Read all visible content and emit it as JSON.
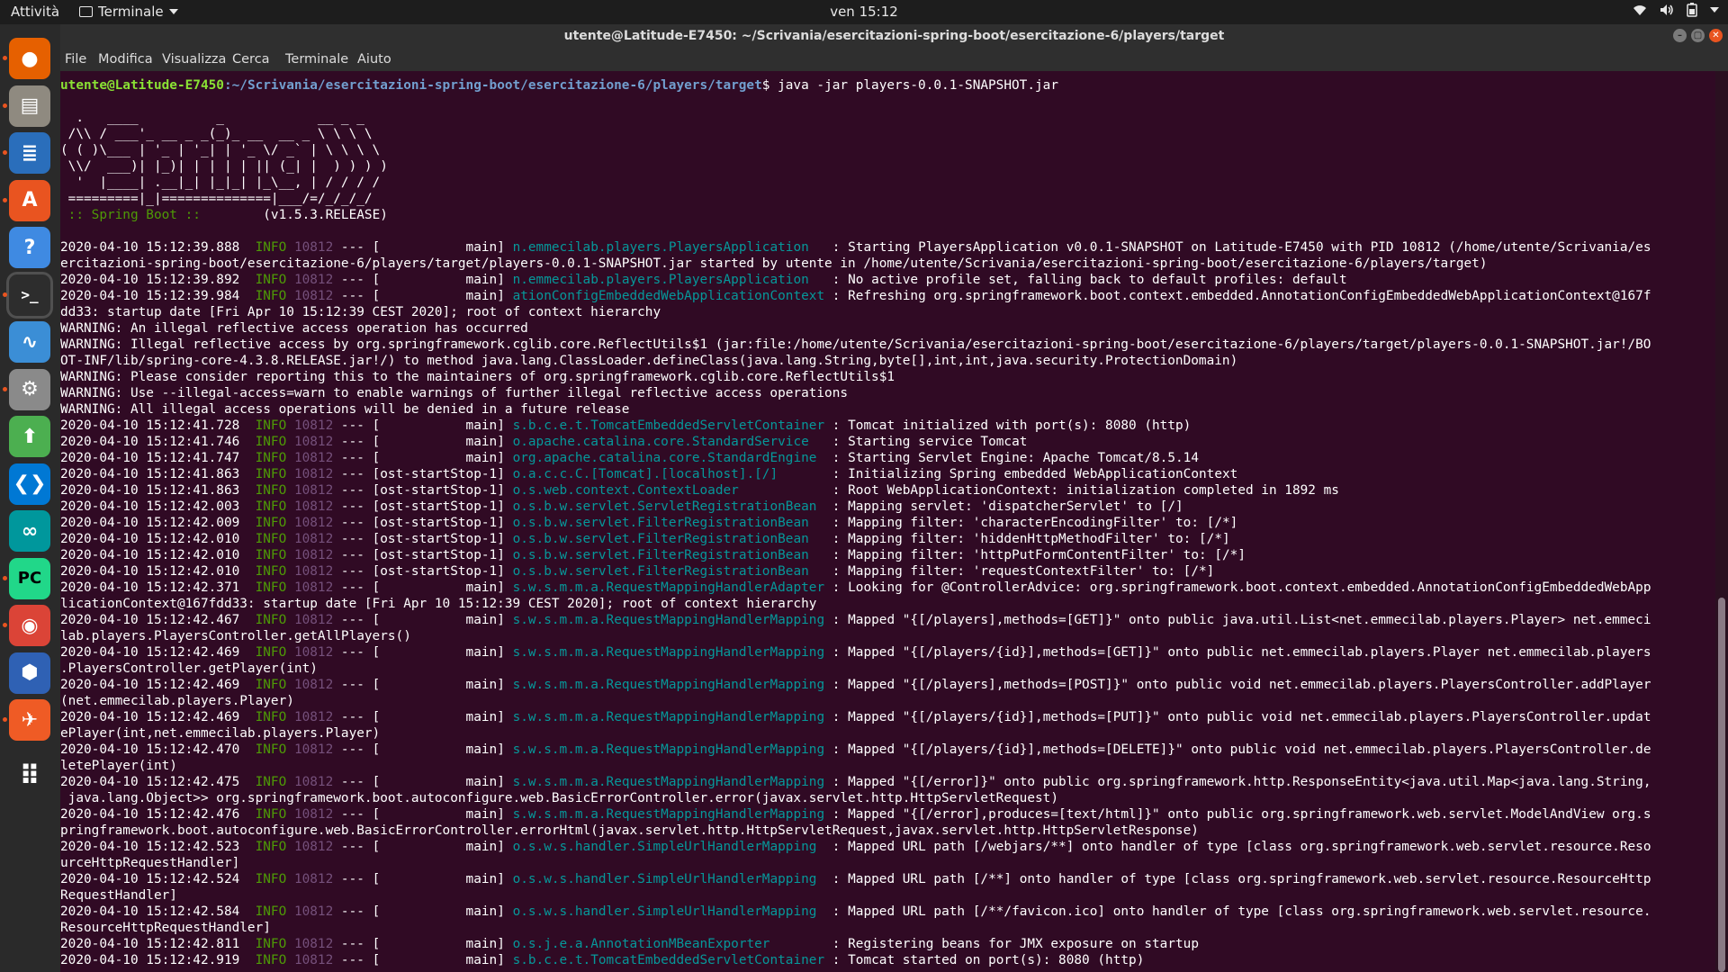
{
  "topbar": {
    "activities": "Attività",
    "app_name": "Terminale",
    "clock": "ven 15:12"
  },
  "dock": {
    "items": [
      {
        "name": "firefox-icon",
        "color": "#e66000"
      },
      {
        "name": "files-icon",
        "color": "#8f8a80"
      },
      {
        "name": "writer-icon",
        "color": "#2a6ebb"
      },
      {
        "name": "software-icon",
        "color": "#e95420"
      },
      {
        "name": "help-icon",
        "color": "#3f8ae2"
      },
      {
        "name": "terminal-icon",
        "color": "#2d2d2d"
      },
      {
        "name": "monitor-icon",
        "color": "#3b8ed6"
      },
      {
        "name": "settings-icon",
        "color": "#8a8a8a"
      },
      {
        "name": "package-icon",
        "color": "#4caf50"
      },
      {
        "name": "vscode-icon",
        "color": "#0078d4"
      },
      {
        "name": "arduino-icon",
        "color": "#00979c"
      },
      {
        "name": "pycharm-icon",
        "color": "#21d789"
      },
      {
        "name": "chrome-icon",
        "color": "#db4437"
      },
      {
        "name": "virtualbox-icon",
        "color": "#2f61b4"
      },
      {
        "name": "postman-icon",
        "color": "#ef5b25"
      },
      {
        "name": "app-grid-icon",
        "color": "#2a2a2a"
      }
    ]
  },
  "window": {
    "title": "utente@Latitude-E7450: ~/Scrivania/esercitazioni-spring-boot/esercitazione-6/players/target"
  },
  "menubar": {
    "items": [
      "File",
      "Modifica",
      "Visualizza",
      "Cerca",
      "Terminale",
      "Aiuto"
    ]
  },
  "terminal": {
    "prompt_user": "utente@Latitude-E7450",
    "prompt_path": ":~/Scrivania/esercitazioni-spring-boot/esercitazione-6/players/target",
    "prompt_sign": "$ ",
    "command": "java -jar players-0.0.1-SNAPSHOT.jar",
    "banner": [
      "  .   ____          _            __ _ _",
      " /\\\\ / ___'_ __ _ _(_)_ __  __ _ \\ \\ \\ \\",
      "( ( )\\___ | '_ | '_| | '_ \\/ _` | \\ \\ \\ \\",
      " \\\\/  ___)| |_)| | | | | || (_| |  ) ) ) )",
      "  '  |____| .__|_| |_|_| |_\\__, | / / / /",
      " =========|_|==============|___/=/_/_/_/"
    ],
    "spring_tag": " :: Spring Boot :: ",
    "spring_version": "       (v1.5.3.RELEASE)",
    "lines": [
      {
        "t": "log",
        "ts": "2020-04-10 15:12:39.888",
        "lvl": "INFO",
        "pid": "10812",
        "th": "[           main]",
        "lg": "n.emmecilab.players.PlayersApplication   ",
        "msg": ": Starting PlayersApplication v0.0.1-SNAPSHOT on Latitude-E7450 with PID 10812 (/home/utente/Scrivania/es"
      },
      {
        "t": "plain",
        "text": "ercitazioni-spring-boot/esercitazione-6/players/target/players-0.0.1-SNAPSHOT.jar started by utente in /home/utente/Scrivania/esercitazioni-spring-boot/esercitazione-6/players/target)"
      },
      {
        "t": "log",
        "ts": "2020-04-10 15:12:39.892",
        "lvl": "INFO",
        "pid": "10812",
        "th": "[           main]",
        "lg": "n.emmecilab.players.PlayersApplication   ",
        "msg": ": No active profile set, falling back to default profiles: default"
      },
      {
        "t": "log",
        "ts": "2020-04-10 15:12:39.984",
        "lvl": "INFO",
        "pid": "10812",
        "th": "[           main]",
        "lg": "ationConfigEmbeddedWebApplicationContext ",
        "msg": ": Refreshing org.springframework.boot.context.embedded.AnnotationConfigEmbeddedWebApplicationContext@167f"
      },
      {
        "t": "plain",
        "text": "dd33: startup date [Fri Apr 10 15:12:39 CEST 2020]; root of context hierarchy"
      },
      {
        "t": "plain",
        "text": "WARNING: An illegal reflective access operation has occurred"
      },
      {
        "t": "plain",
        "text": "WARNING: Illegal reflective access by org.springframework.cglib.core.ReflectUtils$1 (jar:file:/home/utente/Scrivania/esercitazioni-spring-boot/esercitazione-6/players/target/players-0.0.1-SNAPSHOT.jar!/BO"
      },
      {
        "t": "plain",
        "text": "OT-INF/lib/spring-core-4.3.8.RELEASE.jar!/) to method java.lang.ClassLoader.defineClass(java.lang.String,byte[],int,int,java.security.ProtectionDomain)"
      },
      {
        "t": "plain",
        "text": "WARNING: Please consider reporting this to the maintainers of org.springframework.cglib.core.ReflectUtils$1"
      },
      {
        "t": "plain",
        "text": "WARNING: Use --illegal-access=warn to enable warnings of further illegal reflective access operations"
      },
      {
        "t": "plain",
        "text": "WARNING: All illegal access operations will be denied in a future release"
      },
      {
        "t": "log",
        "ts": "2020-04-10 15:12:41.728",
        "lvl": "INFO",
        "pid": "10812",
        "th": "[           main]",
        "lg": "s.b.c.e.t.TomcatEmbeddedServletContainer ",
        "msg": ": Tomcat initialized with port(s): 8080 (http)"
      },
      {
        "t": "log",
        "ts": "2020-04-10 15:12:41.746",
        "lvl": "INFO",
        "pid": "10812",
        "th": "[           main]",
        "lg": "o.apache.catalina.core.StandardService   ",
        "msg": ": Starting service Tomcat"
      },
      {
        "t": "log",
        "ts": "2020-04-10 15:12:41.747",
        "lvl": "INFO",
        "pid": "10812",
        "th": "[           main]",
        "lg": "org.apache.catalina.core.StandardEngine  ",
        "msg": ": Starting Servlet Engine: Apache Tomcat/8.5.14"
      },
      {
        "t": "log",
        "ts": "2020-04-10 15:12:41.863",
        "lvl": "INFO",
        "pid": "10812",
        "th": "[ost-startStop-1]",
        "lg": "o.a.c.c.C.[Tomcat].[localhost].[/]       ",
        "msg": ": Initializing Spring embedded WebApplicationContext"
      },
      {
        "t": "log",
        "ts": "2020-04-10 15:12:41.863",
        "lvl": "INFO",
        "pid": "10812",
        "th": "[ost-startStop-1]",
        "lg": "o.s.web.context.ContextLoader            ",
        "msg": ": Root WebApplicationContext: initialization completed in 1892 ms"
      },
      {
        "t": "log",
        "ts": "2020-04-10 15:12:42.003",
        "lvl": "INFO",
        "pid": "10812",
        "th": "[ost-startStop-1]",
        "lg": "o.s.b.w.servlet.ServletRegistrationBean  ",
        "msg": ": Mapping servlet: 'dispatcherServlet' to [/]"
      },
      {
        "t": "log",
        "ts": "2020-04-10 15:12:42.009",
        "lvl": "INFO",
        "pid": "10812",
        "th": "[ost-startStop-1]",
        "lg": "o.s.b.w.servlet.FilterRegistrationBean   ",
        "msg": ": Mapping filter: 'characterEncodingFilter' to: [/*]"
      },
      {
        "t": "log",
        "ts": "2020-04-10 15:12:42.010",
        "lvl": "INFO",
        "pid": "10812",
        "th": "[ost-startStop-1]",
        "lg": "o.s.b.w.servlet.FilterRegistrationBean   ",
        "msg": ": Mapping filter: 'hiddenHttpMethodFilter' to: [/*]"
      },
      {
        "t": "log",
        "ts": "2020-04-10 15:12:42.010",
        "lvl": "INFO",
        "pid": "10812",
        "th": "[ost-startStop-1]",
        "lg": "o.s.b.w.servlet.FilterRegistrationBean   ",
        "msg": ": Mapping filter: 'httpPutFormContentFilter' to: [/*]"
      },
      {
        "t": "log",
        "ts": "2020-04-10 15:12:42.010",
        "lvl": "INFO",
        "pid": "10812",
        "th": "[ost-startStop-1]",
        "lg": "o.s.b.w.servlet.FilterRegistrationBean   ",
        "msg": ": Mapping filter: 'requestContextFilter' to: [/*]"
      },
      {
        "t": "log",
        "ts": "2020-04-10 15:12:42.371",
        "lvl": "INFO",
        "pid": "10812",
        "th": "[           main]",
        "lg": "s.w.s.m.m.a.RequestMappingHandlerAdapter ",
        "msg": ": Looking for @ControllerAdvice: org.springframework.boot.context.embedded.AnnotationConfigEmbeddedWebApp"
      },
      {
        "t": "plain",
        "text": "licationContext@167fdd33: startup date [Fri Apr 10 15:12:39 CEST 2020]; root of context hierarchy"
      },
      {
        "t": "log",
        "ts": "2020-04-10 15:12:42.467",
        "lvl": "INFO",
        "pid": "10812",
        "th": "[           main]",
        "lg": "s.w.s.m.m.a.RequestMappingHandlerMapping ",
        "msg": ": Mapped \"{[/players],methods=[GET]}\" onto public java.util.List<net.emmecilab.players.Player> net.emmeci"
      },
      {
        "t": "plain",
        "text": "lab.players.PlayersController.getAllPlayers()"
      },
      {
        "t": "log",
        "ts": "2020-04-10 15:12:42.469",
        "lvl": "INFO",
        "pid": "10812",
        "th": "[           main]",
        "lg": "s.w.s.m.m.a.RequestMappingHandlerMapping ",
        "msg": ": Mapped \"{[/players/{id}],methods=[GET]}\" onto public net.emmecilab.players.Player net.emmecilab.players"
      },
      {
        "t": "plain",
        "text": ".PlayersController.getPlayer(int)"
      },
      {
        "t": "log",
        "ts": "2020-04-10 15:12:42.469",
        "lvl": "INFO",
        "pid": "10812",
        "th": "[           main]",
        "lg": "s.w.s.m.m.a.RequestMappingHandlerMapping ",
        "msg": ": Mapped \"{[/players],methods=[POST]}\" onto public void net.emmecilab.players.PlayersController.addPlayer"
      },
      {
        "t": "plain",
        "text": "(net.emmecilab.players.Player)"
      },
      {
        "t": "log",
        "ts": "2020-04-10 15:12:42.469",
        "lvl": "INFO",
        "pid": "10812",
        "th": "[           main]",
        "lg": "s.w.s.m.m.a.RequestMappingHandlerMapping ",
        "msg": ": Mapped \"{[/players/{id}],methods=[PUT]}\" onto public void net.emmecilab.players.PlayersController.updat"
      },
      {
        "t": "plain",
        "text": "ePlayer(int,net.emmecilab.players.Player)"
      },
      {
        "t": "log",
        "ts": "2020-04-10 15:12:42.470",
        "lvl": "INFO",
        "pid": "10812",
        "th": "[           main]",
        "lg": "s.w.s.m.m.a.RequestMappingHandlerMapping ",
        "msg": ": Mapped \"{[/players/{id}],methods=[DELETE]}\" onto public void net.emmecilab.players.PlayersController.de"
      },
      {
        "t": "plain",
        "text": "letePlayer(int)"
      },
      {
        "t": "log",
        "ts": "2020-04-10 15:12:42.475",
        "lvl": "INFO",
        "pid": "10812",
        "th": "[           main]",
        "lg": "s.w.s.m.m.a.RequestMappingHandlerMapping ",
        "msg": ": Mapped \"{[/error]}\" onto public org.springframework.http.ResponseEntity<java.util.Map<java.lang.String,"
      },
      {
        "t": "plain",
        "text": " java.lang.Object>> org.springframework.boot.autoconfigure.web.BasicErrorController.error(javax.servlet.http.HttpServletRequest)"
      },
      {
        "t": "log",
        "ts": "2020-04-10 15:12:42.476",
        "lvl": "INFO",
        "pid": "10812",
        "th": "[           main]",
        "lg": "s.w.s.m.m.a.RequestMappingHandlerMapping ",
        "msg": ": Mapped \"{[/error],produces=[text/html]}\" onto public org.springframework.web.servlet.ModelAndView org.s"
      },
      {
        "t": "plain",
        "text": "pringframework.boot.autoconfigure.web.BasicErrorController.errorHtml(javax.servlet.http.HttpServletRequest,javax.servlet.http.HttpServletResponse)"
      },
      {
        "t": "log",
        "ts": "2020-04-10 15:12:42.523",
        "lvl": "INFO",
        "pid": "10812",
        "th": "[           main]",
        "lg": "o.s.w.s.handler.SimpleUrlHandlerMapping  ",
        "msg": ": Mapped URL path [/webjars/**] onto handler of type [class org.springframework.web.servlet.resource.Reso"
      },
      {
        "t": "plain",
        "text": "urceHttpRequestHandler]"
      },
      {
        "t": "log",
        "ts": "2020-04-10 15:12:42.524",
        "lvl": "INFO",
        "pid": "10812",
        "th": "[           main]",
        "lg": "o.s.w.s.handler.SimpleUrlHandlerMapping  ",
        "msg": ": Mapped URL path [/**] onto handler of type [class org.springframework.web.servlet.resource.ResourceHttp"
      },
      {
        "t": "plain",
        "text": "RequestHandler]"
      },
      {
        "t": "log",
        "ts": "2020-04-10 15:12:42.584",
        "lvl": "INFO",
        "pid": "10812",
        "th": "[           main]",
        "lg": "o.s.w.s.handler.SimpleUrlHandlerMapping  ",
        "msg": ": Mapped URL path [/**/favicon.ico] onto handler of type [class org.springframework.web.servlet.resource."
      },
      {
        "t": "plain",
        "text": "ResourceHttpRequestHandler]"
      },
      {
        "t": "log",
        "ts": "2020-04-10 15:12:42.811",
        "lvl": "INFO",
        "pid": "10812",
        "th": "[           main]",
        "lg": "o.s.j.e.a.AnnotationMBeanExporter        ",
        "msg": ": Registering beans for JMX exposure on startup"
      },
      {
        "t": "log",
        "ts": "2020-04-10 15:12:42.919",
        "lvl": "INFO",
        "pid": "10812",
        "th": "[           main]",
        "lg": "s.b.c.e.t.TomcatEmbeddedServletContainer ",
        "msg": ": Tomcat started on port(s): 8080 (http)"
      }
    ]
  }
}
